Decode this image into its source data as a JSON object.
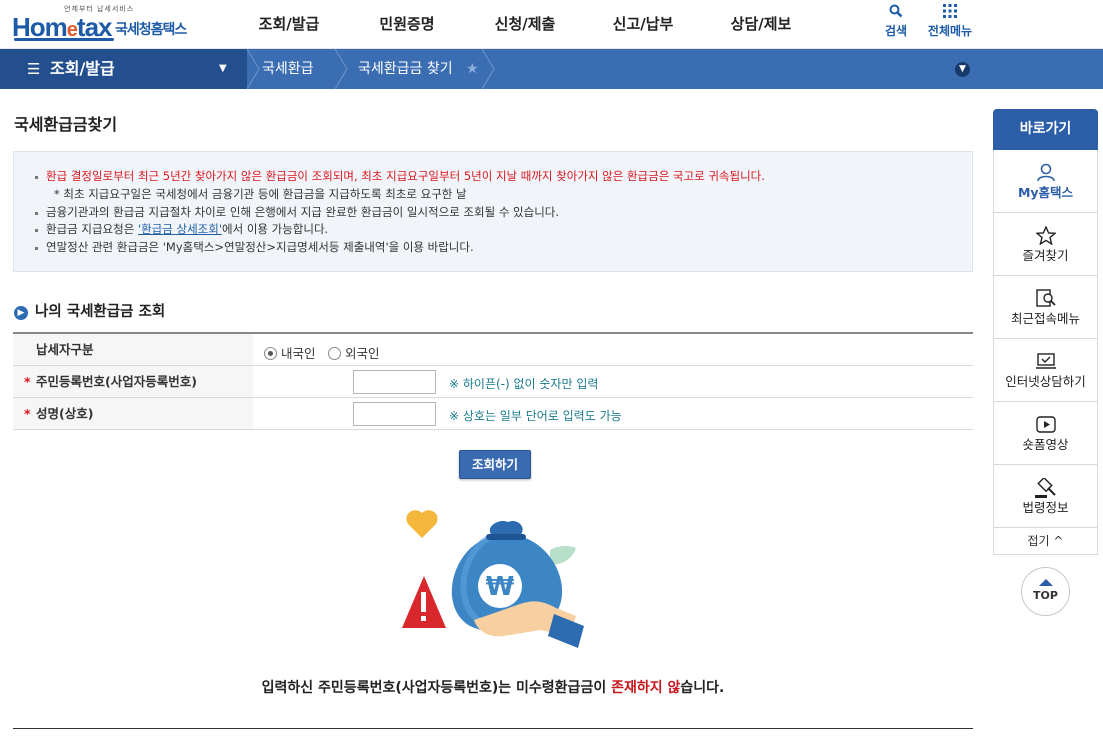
{
  "header": {
    "logo_tagline": "언제부터 납세서비스",
    "logo_home": "Hom",
    "logo_e": "e",
    "logo_tax": "tax",
    "logo_kr": "국세청홈택스",
    "gnb": [
      "조회/발급",
      "민원증명",
      "신청/제출",
      "신고/납부",
      "상담/제보"
    ],
    "search_label": "검색",
    "allmenu_label": "전체메뉴"
  },
  "navbar": {
    "home_label": "조회/발급",
    "crumbs": [
      "국세환급",
      "국세환급금 찾기"
    ]
  },
  "page": {
    "title": "국세환급금찾기",
    "notice": {
      "line1": "환급 결정일로부터 최근 5년간 찾아가지 않은 환급금이 조회되며, 최초 지급요구일부터 5년이 지날 때까지 찾아가지 않은 환급금은 국고로 귀속됩니다.",
      "line2": "* 최초 지급요구일은 국세청에서 금융기관 등에 환급금을 지급하도록 최초로 요구한 날",
      "line3": "금융기관과의 환급금 지급절차 차이로 인해 은행에서 지급 완료한 환급금이 일시적으로 조회될 수 있습니다.",
      "line4_pre": "환급금 지급요청은 ",
      "line4_link": "'환급금 상세조회'",
      "line4_post": "에서 이용 가능합니다.",
      "line5": "연말정산 관련 환급금은 'My홈택스>연말정산>지급명세서등 제출내역'을 이용 바랍니다."
    },
    "section_title": "나의 국세환급금 조회",
    "form": {
      "type_label": "납세자구분",
      "opt_domestic": "내국인",
      "opt_foreign": "외국인",
      "id_label": "주민등록번호(사업자등록번호)",
      "id_hint": "※ 하이픈(-) 없이 숫자만 입력",
      "name_label": "성명(상호)",
      "name_hint": "※ 상호는 일부 단어로 입력도 가능",
      "required_mark": "*",
      "submit_label": "조회하기"
    },
    "result": {
      "pre": "입력하신 주민등록번호(사업자등록번호)는 미수령환급금이 ",
      "highlight": "존재하지 않",
      "post": "습니다."
    }
  },
  "quick": {
    "title": "바로가기",
    "items": [
      "My홈택스",
      "즐겨찾기",
      "최근접속메뉴",
      "인터넷상담하기",
      "숏폼영상",
      "법령정보"
    ],
    "fold_label": "접기 ^",
    "top_label": "TOP"
  }
}
